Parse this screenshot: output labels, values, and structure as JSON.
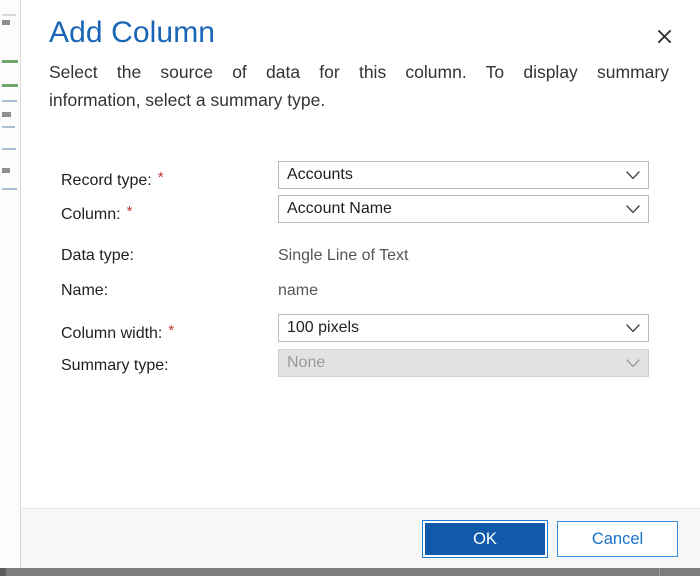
{
  "dialog": {
    "title": "Add Column",
    "description_line1": "Select the source of data for this column. To display summary",
    "description_line2": "information, select a summary type.",
    "close_label": "✕"
  },
  "form": {
    "rows": [
      {
        "label": "Record type:",
        "required": true,
        "required_mark": "*",
        "control": "select",
        "value": "Accounts",
        "disabled": false
      },
      {
        "label": "Column:",
        "required": true,
        "required_mark": "*",
        "control": "select",
        "value": "Account Name",
        "disabled": false
      },
      {
        "label": "Data type:",
        "required": false,
        "required_mark": "",
        "control": "text",
        "value": "Single Line of Text",
        "disabled": false
      },
      {
        "label": "Name:",
        "required": false,
        "required_mark": "",
        "control": "text",
        "value": "name",
        "disabled": false
      },
      {
        "label": "Column width:",
        "required": true,
        "required_mark": "*",
        "control": "select",
        "value": "100 pixels",
        "disabled": false
      },
      {
        "label": "Summary type:",
        "required": false,
        "required_mark": "",
        "control": "select",
        "value": "None",
        "disabled": true
      }
    ]
  },
  "footer": {
    "ok_label": "OK",
    "cancel_label": "Cancel"
  },
  "colors": {
    "title_blue": "#1a66b5",
    "primary_button": "#1059ab",
    "link_blue": "#1a72c9",
    "required_red": "#c0392b",
    "footer_bg": "#f7f7f7",
    "field_border": "#b9b9b9",
    "disabled_bg": "#e2e2e2"
  }
}
